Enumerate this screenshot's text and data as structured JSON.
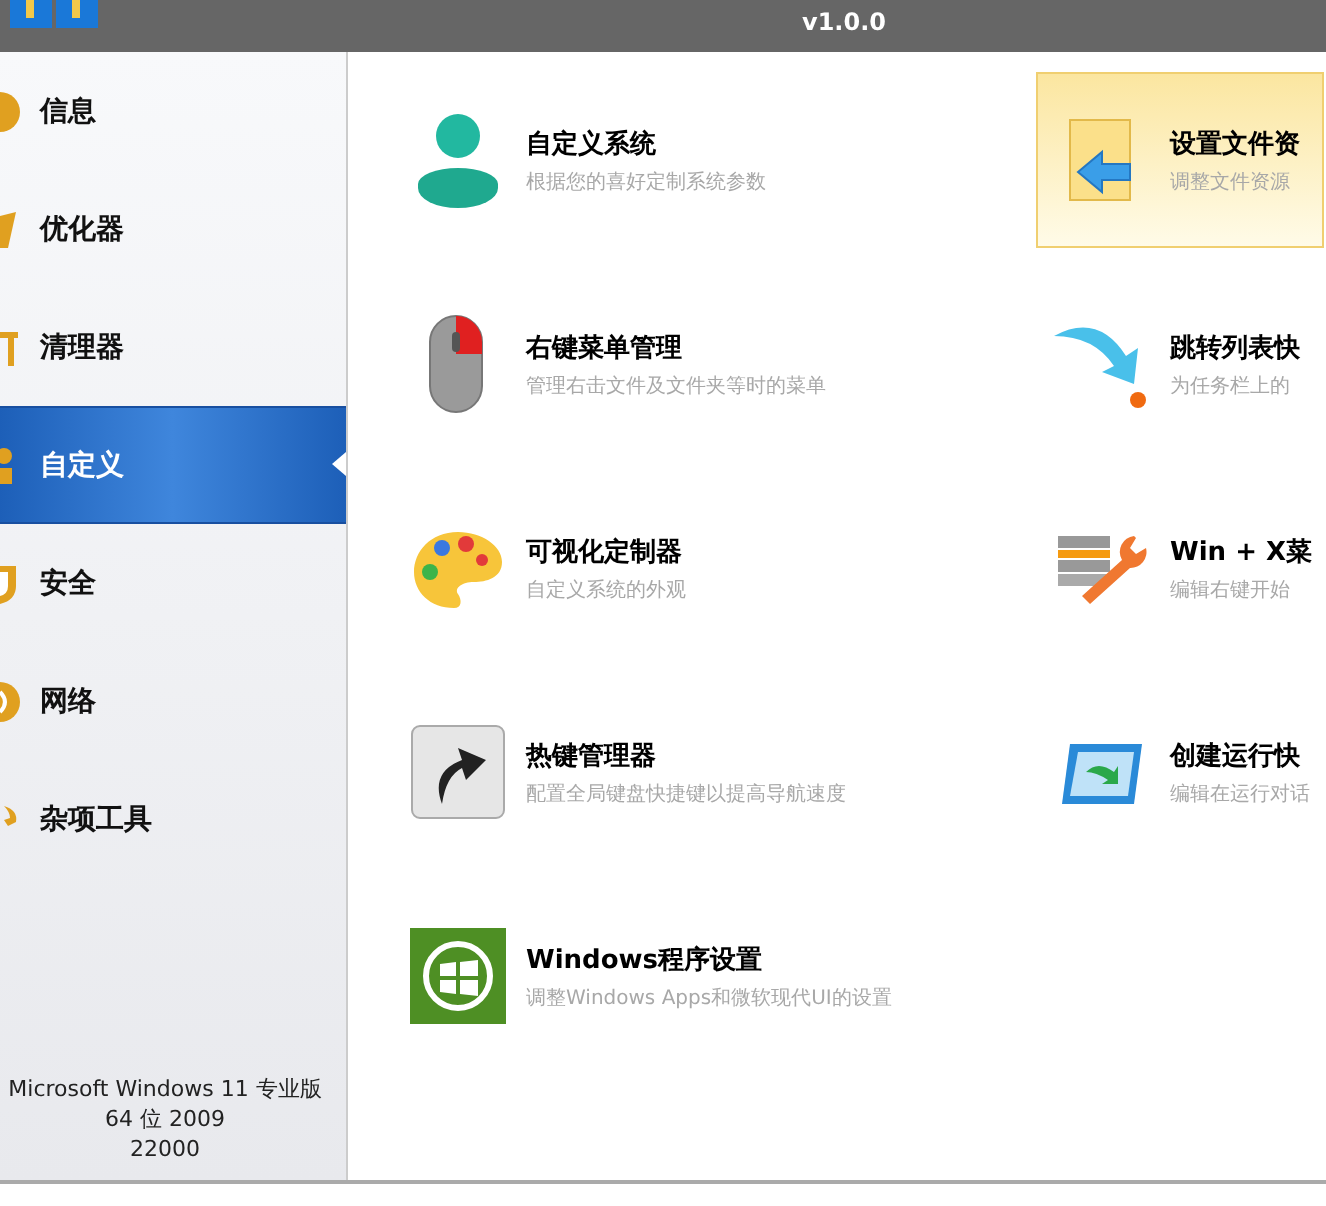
{
  "title_bar": {
    "version": "v1.0.0"
  },
  "sidebar": {
    "items": [
      {
        "label": "信息",
        "selected": false
      },
      {
        "label": "优化器",
        "selected": false
      },
      {
        "label": "清理器",
        "selected": false
      },
      {
        "label": "自定义",
        "selected": true
      },
      {
        "label": "安全",
        "selected": false
      },
      {
        "label": "网络",
        "selected": false
      },
      {
        "label": "杂项工具",
        "selected": false
      }
    ],
    "system_info": [
      "Microsoft Windows 11 专业版",
      "64 位 2009",
      "22000"
    ]
  },
  "tools": [
    {
      "title": "自定义系统",
      "description": "根据您的喜好定制系统参数",
      "selected": false
    },
    {
      "title": "设置文件资",
      "description": "调整文件资源",
      "selected": true
    },
    {
      "title": "右键菜单管理",
      "description": "管理右击文件及文件夹等时的菜单",
      "selected": false
    },
    {
      "title": "跳转列表快",
      "description": "为任务栏上的",
      "selected": false
    },
    {
      "title": "可视化定制器",
      "description": "自定义系统的外观",
      "selected": false
    },
    {
      "title": "Win + X菜",
      "description": "编辑右键开始",
      "selected": false
    },
    {
      "title": "热键管理器",
      "description": "配置全局键盘快捷键以提高导航速度",
      "selected": false
    },
    {
      "title": "创建运行快",
      "description": "编辑在运行对话",
      "selected": false
    },
    {
      "title": "Windows程序设置",
      "description": "调整Windows Apps和微软现代UI的设置",
      "selected": false
    }
  ]
}
